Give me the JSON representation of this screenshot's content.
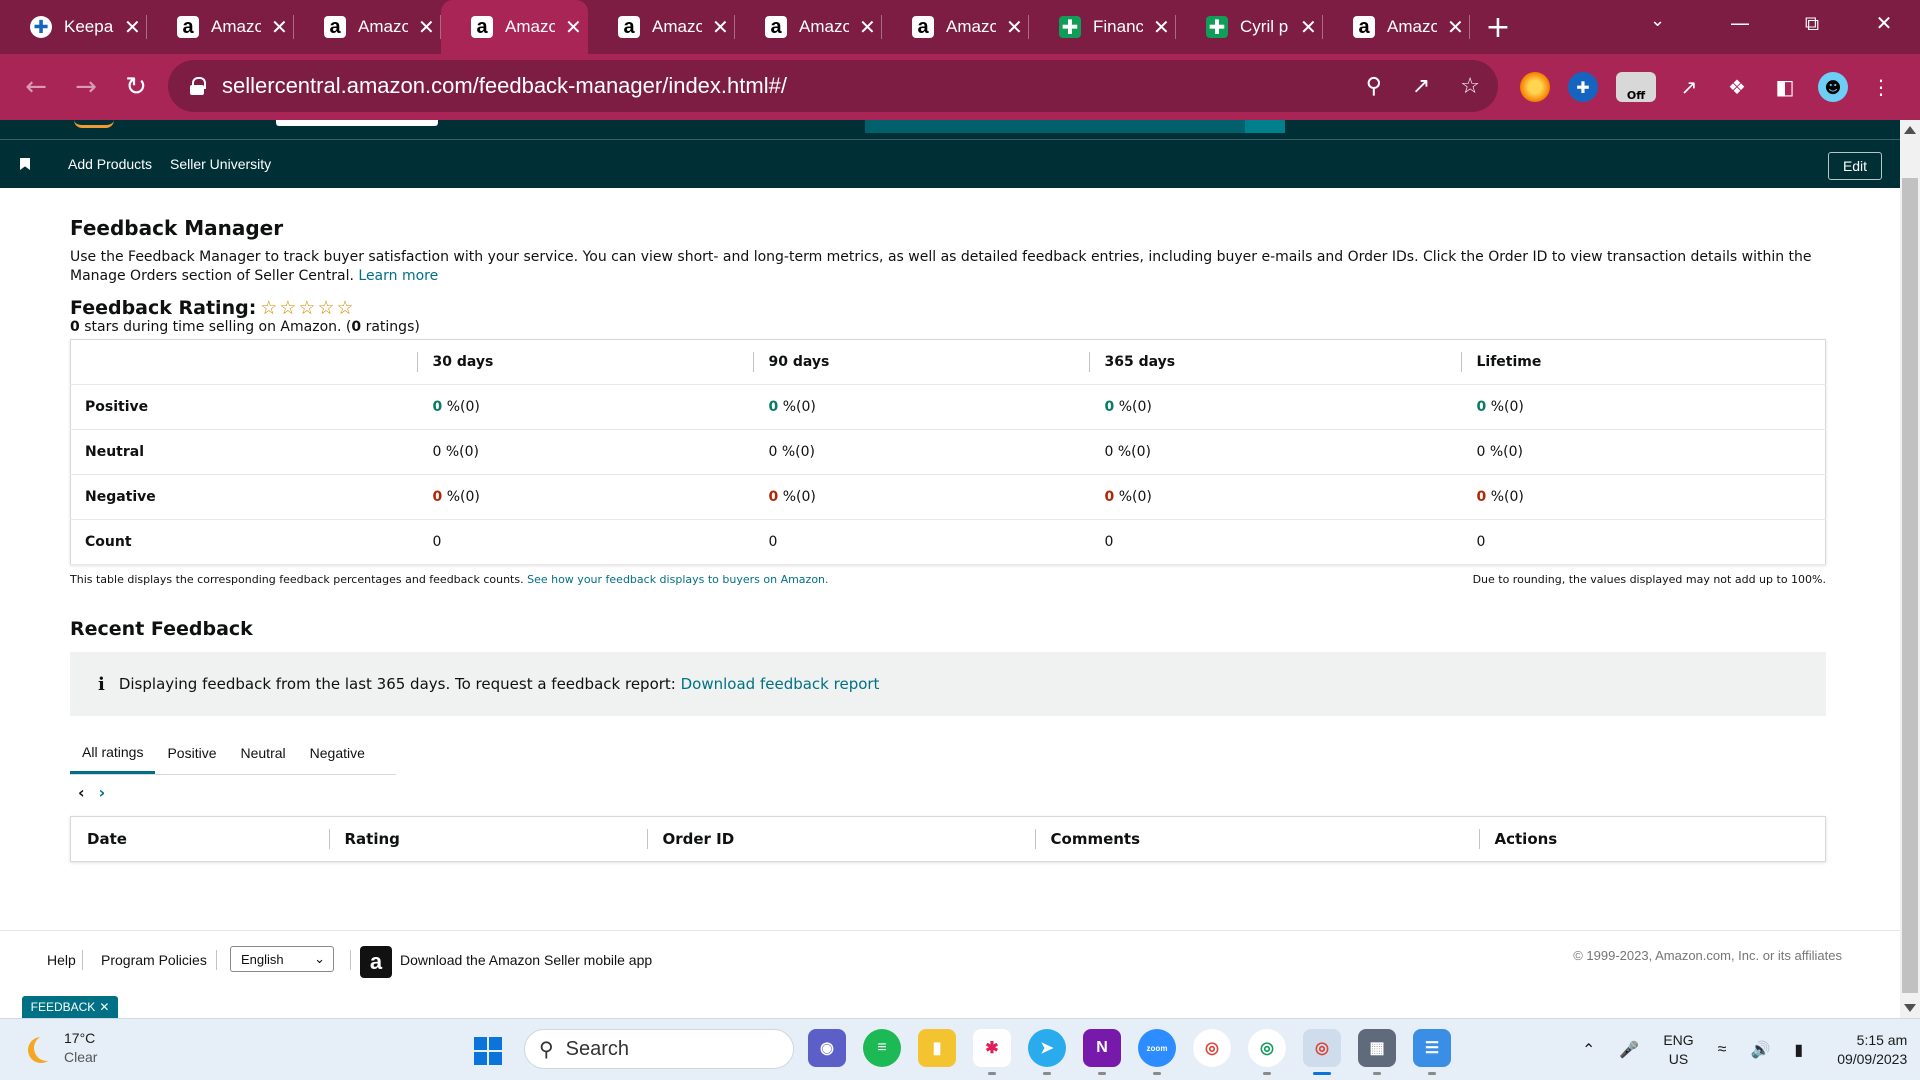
{
  "browser": {
    "tabs": [
      {
        "title": "Keepa",
        "favicon": "keepa-icon",
        "active": false
      },
      {
        "title": "Amazon",
        "favicon": "amazon-icon",
        "active": false
      },
      {
        "title": "Amazon",
        "favicon": "amazon-icon",
        "active": false
      },
      {
        "title": "Amazon",
        "favicon": "amazon-icon",
        "active": true
      },
      {
        "title": "Amazon",
        "favicon": "amazon-icon",
        "active": false
      },
      {
        "title": "Amazon",
        "favicon": "amazon-icon",
        "active": false
      },
      {
        "title": "Amazon",
        "favicon": "amazon-icon",
        "active": false
      },
      {
        "title": "Finance",
        "favicon": "sheets-icon",
        "active": false
      },
      {
        "title": "Cyril p",
        "favicon": "sheets-icon",
        "active": false
      },
      {
        "title": "Amazon",
        "favicon": "amazon-icon",
        "active": false
      }
    ],
    "url": "sellercentral.amazon.com/feedback-manager/index.html#/",
    "theme_color": "#a82555",
    "extension_off_badge": "Off"
  },
  "header": {
    "nav_links": [
      "Add Products",
      "Seller University"
    ],
    "edit_label": "Edit"
  },
  "page": {
    "title": "Feedback Manager",
    "intro": "Use the Feedback Manager to track buyer satisfaction with your service. You can view short- and long-term metrics, as well as detailed feedback entries, including buyer e-mails and Order IDs. Click the Order ID to view transaction details within the Manage Orders section of Seller Central.",
    "learn_more": "Learn more",
    "rating_label": "Feedback Rating:",
    "stars_count": 5,
    "stars_filled": 0,
    "rating_summary_stars": "0",
    "rating_summary_mid": " stars during time selling on Amazon. (",
    "rating_summary_count": "0",
    "rating_summary_end": " ratings)"
  },
  "metrics_table": {
    "columns": [
      "30 days",
      "90 days",
      "365 days",
      "Lifetime"
    ],
    "rows": [
      {
        "label": "Positive",
        "kind": "pos",
        "cells": [
          {
            "value": "0",
            "rest": " %(0)"
          },
          {
            "value": "0",
            "rest": " %(0)"
          },
          {
            "value": "0",
            "rest": " %(0)"
          },
          {
            "value": "0",
            "rest": " %(0)"
          }
        ]
      },
      {
        "label": "Neutral",
        "kind": "neu",
        "cells": [
          {
            "value": "0",
            "rest": " %(0)"
          },
          {
            "value": "0",
            "rest": " %(0)"
          },
          {
            "value": "0",
            "rest": " %(0)"
          },
          {
            "value": "0",
            "rest": " %(0)"
          }
        ]
      },
      {
        "label": "Negative",
        "kind": "neg",
        "cells": [
          {
            "value": "0",
            "rest": " %(0)"
          },
          {
            "value": "0",
            "rest": " %(0)"
          },
          {
            "value": "0",
            "rest": " %(0)"
          },
          {
            "value": "0",
            "rest": " %(0)"
          }
        ]
      },
      {
        "label": "Count",
        "kind": "count",
        "cells": [
          {
            "value": "0",
            "rest": ""
          },
          {
            "value": "0",
            "rest": ""
          },
          {
            "value": "0",
            "rest": ""
          },
          {
            "value": "0",
            "rest": ""
          }
        ]
      }
    ],
    "footnote": "This table displays the corresponding feedback percentages and feedback counts.",
    "footnote_link": "See how your feedback displays to buyers on Amazon.",
    "rounding_note": "Due to rounding, the values displayed may not add up to 100%.",
    "colors": {
      "positive": "#067d62",
      "negative": "#b12704"
    }
  },
  "recent": {
    "title": "Recent Feedback",
    "info_text": "Displaying feedback from the last 365 days. To request a feedback report:",
    "info_link": "Download feedback report",
    "tabs": [
      "All ratings",
      "Positive",
      "Neutral",
      "Negative"
    ],
    "active_tab": "All ratings",
    "columns": [
      "Date",
      "Rating",
      "Order ID",
      "Comments",
      "Actions"
    ]
  },
  "footer": {
    "help": "Help",
    "policies": "Program Policies",
    "language": "English",
    "app_text": "Download the Amazon Seller mobile app",
    "copyright": "© 1999-2023, Amazon.com, Inc. or its affiliates",
    "feedback_tab": "FEEDBACK"
  },
  "taskbar": {
    "temperature": "17°C",
    "weather": "Clear",
    "search_placeholder": "Search",
    "lang_top": "ENG",
    "lang_bottom": "US",
    "time": "5:15 am",
    "date": "09/09/2023",
    "zoom_label": "zoom"
  }
}
